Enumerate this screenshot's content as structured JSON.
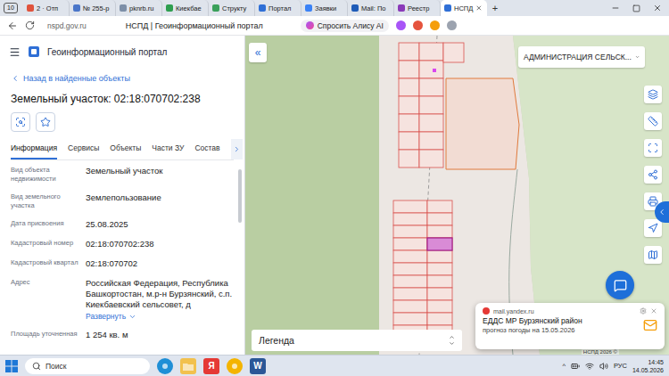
{
  "browser": {
    "tab_count": "10",
    "tabs": [
      {
        "label": "2 · Отп",
        "selected": false,
        "color": "#e0533d"
      },
      {
        "label": "№ 255-р",
        "selected": false,
        "color": "#4a76c9"
      },
      {
        "label": "pknrb.ru",
        "selected": false,
        "color": "#7d8fa8"
      },
      {
        "label": "Киекбае",
        "selected": false,
        "color": "#2e9e4f"
      },
      {
        "label": "Структу",
        "selected": false,
        "color": "#3aa05a"
      },
      {
        "label": "Портал",
        "selected": false,
        "color": "#2f6fd6"
      },
      {
        "label": "Заявки",
        "selected": false,
        "color": "#3b82f6"
      },
      {
        "label": "Mail: По",
        "selected": false,
        "color": "#1e5bb8"
      },
      {
        "label": "Реестр",
        "selected": false,
        "color": "#8a3ab9"
      },
      {
        "label": "НСПД",
        "selected": true,
        "color": "#2f6fd6"
      }
    ],
    "new_tab": "+"
  },
  "address_bar": {
    "url": "nspd.gov.ru",
    "page_title": "НСПД | Геоинформационный портал",
    "alice": "Спросить Алису AI"
  },
  "portal": {
    "title": "Геоинформационный портал"
  },
  "back_link": "Назад в найденные объекты",
  "object_title": "Земельный участок: 02:18:070702:238",
  "tabs": [
    {
      "label": "Информация",
      "selected": true
    },
    {
      "label": "Сервисы",
      "selected": false
    },
    {
      "label": "Объекты",
      "selected": false
    },
    {
      "label": "Части ЗУ",
      "selected": false
    },
    {
      "label": "Состав",
      "selected": false
    }
  ],
  "fields": [
    {
      "label": "Вид объекта недвижимости",
      "value": "Земельный участок"
    },
    {
      "label": "Вид земельного участка",
      "value": "Землепользование"
    },
    {
      "label": "Дата присвоения",
      "value": "25.08.2025"
    },
    {
      "label": "Кадастровый номер",
      "value": "02:18:070702:238"
    },
    {
      "label": "Кадастровый квартал",
      "value": "02:18:070702"
    },
    {
      "label": "Адрес",
      "value": "Российская Федерация, Республика Башкортостан, м.р-н Бурзянский, с.п. Киекбаевский сельсовет, д",
      "expand": "Развернуть"
    },
    {
      "label": "Площадь уточненная",
      "value": "1 254 кв. м"
    }
  ],
  "map": {
    "collapse": "«",
    "layer_select": "АДМИНИСТРАЦИЯ СЕЛЬСК...",
    "legend": "Легенда",
    "attribution": "НСПД 2026 ©"
  },
  "notification": {
    "source": "mail.yandex.ru",
    "title": "ЕДДС МР Бурзянский район",
    "body": "прогноз погоды на 15.05.2026"
  },
  "taskbar": {
    "search": "Поиск",
    "apps": [
      {
        "kind": "edge",
        "glyph": "",
        "color": "#1f8fd6"
      },
      {
        "kind": "folder",
        "glyph": "",
        "color": "#f2c14e"
      },
      {
        "kind": "letter",
        "glyph": "Я",
        "color": "#e53935"
      },
      {
        "kind": "browser",
        "glyph": "",
        "color": "#f4b400"
      },
      {
        "kind": "letter",
        "glyph": "W",
        "color": "#2b5797"
      }
    ],
    "tray_arrow": "^",
    "language": "РУС",
    "time": "14:45",
    "date": "14.05.2026"
  }
}
